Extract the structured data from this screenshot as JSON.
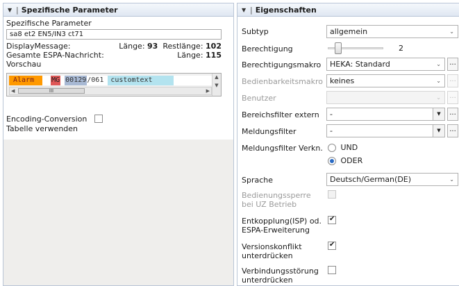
{
  "left_panel": {
    "header": "Spezifische Parameter",
    "section_title": "Spezifische Parameter",
    "address_value": "sa8 et2 EN5/IN3 ct71",
    "display_message_label": "DisplayMessage:",
    "laenge_label": "Länge:",
    "laenge_value": "93",
    "restlaenge_label": "Restlänge:",
    "restlaenge_value": "102",
    "gesamt_label": "Gesamte ESPA-Nachricht:",
    "gesamt_laenge_label": "Länge:",
    "gesamt_laenge_value": "115",
    "vorschau_label": "Vorschau",
    "preview": {
      "alarm": "Alarm",
      "mg": "MG",
      "num": "00129",
      "sub": "/061",
      "text": "customtext",
      "thumb_glyph": "III"
    },
    "encoding_label": "Encoding-Conversion",
    "table_label": "Tabelle verwenden"
  },
  "right_panel": {
    "header": "Eigenschaften",
    "subtyp_label": "Subtyp",
    "subtyp_value": "allgemein",
    "berechtigung_label": "Berechtigung",
    "berechtigung_value": "2",
    "berechtigungsmakro_label": "Berechtigungsmakro",
    "berechtigungsmakro_value": "HEKA: Standard",
    "bedienbarkeitsmakro_label": "Bedienbarkeitsmakro",
    "bedienbarkeitsmakro_value": "keines",
    "benutzer_label": "Benutzer",
    "bereichsfilter_label": "Bereichsfilter extern",
    "bereichsfilter_value": "-",
    "meldungsfilter_label": "Meldungsfilter",
    "meldungsfilter_value": "-",
    "verkn_label": "Meldungsfilter Verkn.",
    "radio_und": "UND",
    "radio_oder": "ODER",
    "sprache_label": "Sprache",
    "sprache_value": "Deutsch/German(DE)",
    "bedienungssperre_label": "Bedienungssperre bei UZ Betrieb",
    "entkopplung_label": "Entkopplung(ISP) od. ESPA-Erweiterung",
    "versionskonflikt_label": "Versionskonflikt unterdrücken",
    "verbindungsstoerung_label": "Verbindungsstörung unterdrücken",
    "ellipsis": "..."
  },
  "colors": {
    "alarm_bg": "#ff9900",
    "mg_bg": "#e05757",
    "num_bg": "#a8b9d4",
    "text_bg": "#b3e3ef",
    "header_border": "#b9c5d6"
  }
}
